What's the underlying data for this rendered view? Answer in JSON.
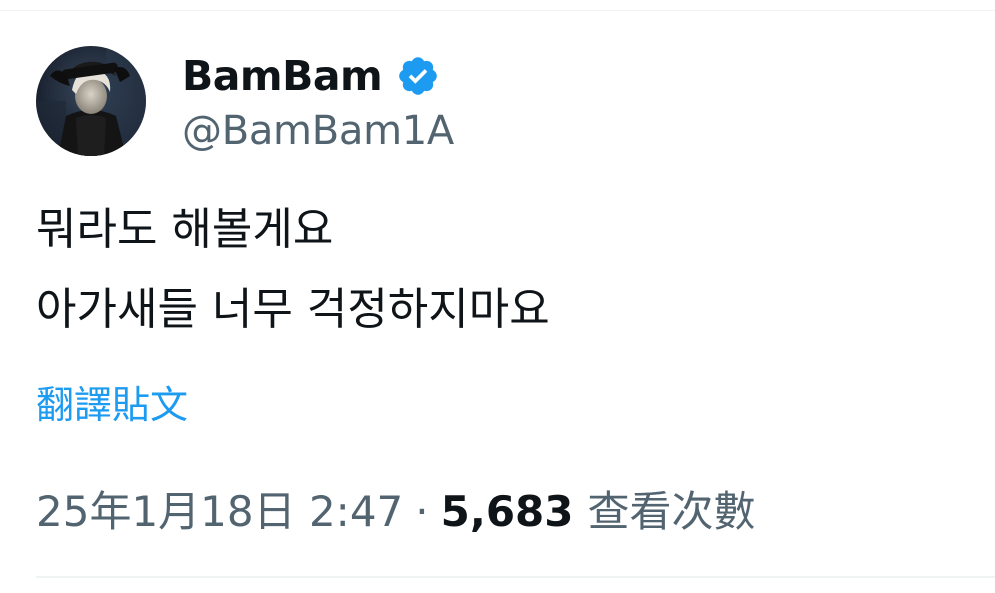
{
  "user": {
    "display_name": "BamBam",
    "handle": "@BamBam1A",
    "verified": true
  },
  "tweet": {
    "lines": [
      "뭐라도 해볼게요",
      "아가새들 너무 걱정하지마요"
    ],
    "translate_label": "翻譯貼文"
  },
  "meta": {
    "timestamp": "25年1月18日 2:47",
    "separator": "·",
    "views_count": "5,683",
    "views_label": "查看次數"
  },
  "colors": {
    "link_blue": "#1d9bf0",
    "verified_blue": "#1d9bf0",
    "text_primary": "#0f1419",
    "text_secondary": "#536471"
  },
  "icons": {
    "verified": "verified-badge-icon",
    "avatar": "profile-avatar"
  }
}
